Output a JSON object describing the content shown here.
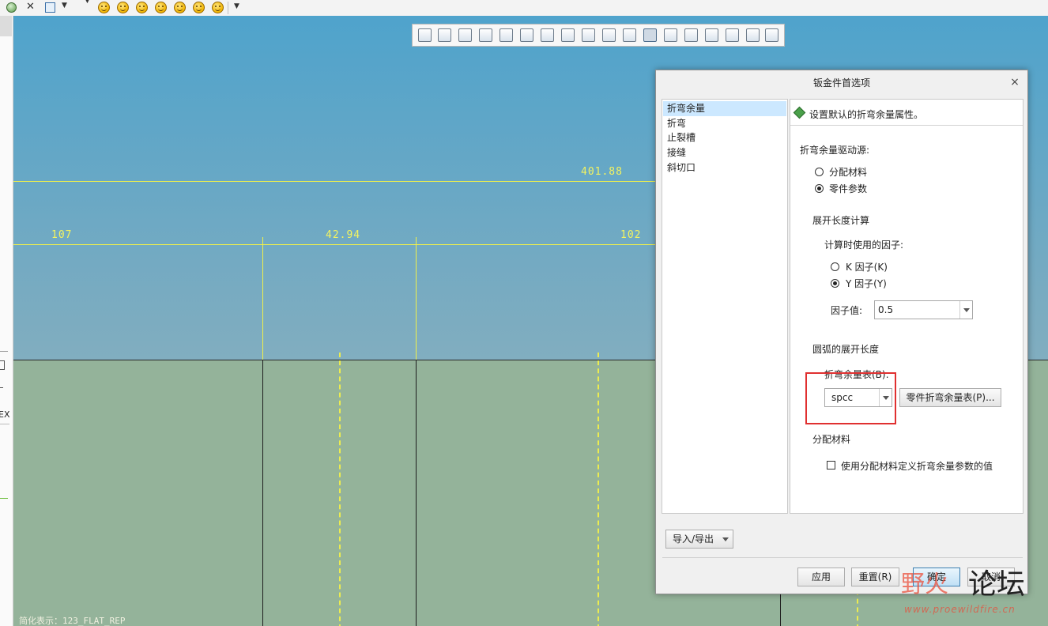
{
  "canvas": {
    "dimensions": {
      "overall": "401.88",
      "left": "107",
      "middle": "42.94",
      "right": "102"
    },
    "simplified_rep_label": "简化表示：123_FLAT_REP",
    "background_top": "#4fa3cc",
    "plate_color": "#94b39a",
    "dimension_color": "#f0f04a"
  },
  "left_strip": {
    "fragment": "EX"
  },
  "dialog": {
    "title": "钣金件首选项",
    "close_symbol": "×",
    "nav_items": [
      {
        "label": "折弯余量",
        "selected": true
      },
      {
        "label": "折弯"
      },
      {
        "label": "止裂槽"
      },
      {
        "label": "接缝"
      },
      {
        "label": "斜切口"
      }
    ],
    "panel": {
      "header": "设置默认的折弯余量属性。",
      "driving_source_label": "折弯余量驱动源:",
      "radio_assign_material": "分配材料",
      "radio_part_params": "零件参数",
      "developed_length_label": "展开长度计算",
      "factor_used_label": "计算时使用的因子:",
      "radio_k_factor": "K 因子(K)",
      "radio_y_factor": "Y 因子(Y)",
      "factor_value_label": "因子值:",
      "factor_value": "0.5",
      "arc_length_label": "圆弧的展开长度",
      "bend_table_label": "折弯余量表(B):",
      "bend_table_value": "spcc",
      "part_bend_table_button": "零件折弯余量表(P)...",
      "assign_material_section": "分配材料",
      "use_material_checkbox": "使用分配材料定义折弯余量参数的值"
    },
    "import_export_button": "导入/导出",
    "buttons": {
      "apply": "应用",
      "reset": "重置(R)",
      "ok": "确定",
      "cancel": "取消"
    }
  },
  "watermark": {
    "text_a": "野火",
    "text_b": "论坛",
    "url": "www.proewildfire.cn"
  }
}
